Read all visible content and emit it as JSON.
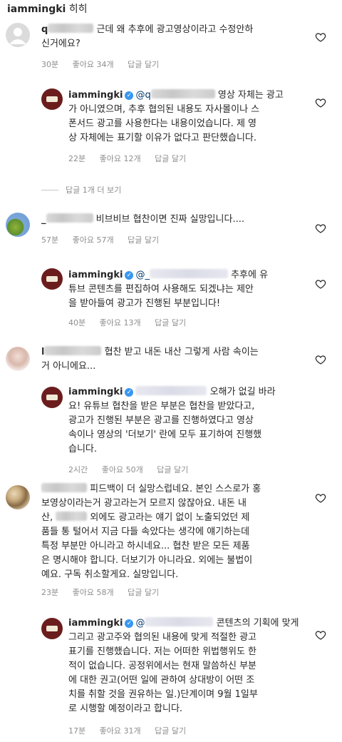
{
  "caption": {
    "username": "iammingki",
    "text": "히히"
  },
  "icons": {
    "heart": "heart-outline-icon",
    "verified": "verified-badge-icon"
  },
  "comments": [
    {
      "user_prefix": "q",
      "lines": [
        "근데 왜 추후에 광고영상이라고 수정안하",
        "신거에요?"
      ],
      "time": "30분",
      "likes": "좋아요 34개",
      "reply": "답글 달기"
    },
    {
      "user": "iammingki",
      "mention_prefix": "@q",
      "lines": [
        "영상 자체는 광고",
        "가 아니였으며, 추후 협의된 내용도 자사몰이나 스",
        "폰서드 광고를 사용한다는 내용이었습니다. 제 영",
        "상 자체에는 표기할 이유가 없다고 판단했습니다."
      ],
      "time": "22분",
      "likes": "좋아요 12개",
      "reply": "답글 달기"
    },
    {
      "view_replies": "답글 1개 더 보기"
    },
    {
      "user_prefix": "_",
      "lines": [
        "비브비브 협찬이면 진짜 실망입니다...."
      ],
      "time": "57분",
      "likes": "좋아요 57개",
      "reply": "답글 달기"
    },
    {
      "user": "iammingki",
      "mention_prefix": "@_",
      "lines": [
        "추후에 유",
        "튜브 콘텐츠를 편집하여 사용해도 되겠냐는 제안",
        "을 받아들여 광고가 진행된 부분입니다!"
      ],
      "time": "40분",
      "likes": "좋아요 13개",
      "reply": "답글 달기"
    },
    {
      "user_prefix": "l",
      "lines": [
        "협찬 받고 내돈 내산 그렇게 사람 속이는",
        "거 아니에요..."
      ],
      "time": "",
      "likes": "",
      "reply": ""
    },
    {
      "user": "iammingki",
      "lines": [
        "오해가 없길 바라",
        "요! 유튜브 협찬을 받은 부분은 협찬을 받았다고,",
        "광고가 진행된 부분은 광고를 진행하였다고 영상",
        "속이나 영상의 '더보기' 란에 모두 표기하여 진행했",
        "습니다."
      ],
      "time": "2시간",
      "likes": "좋아요 50개",
      "reply": "답글 달기"
    },
    {
      "lines": [
        "피드백이 더 실망스럽네요. 본인 스스로가 홍",
        "보영상이라는거 광고라는거 모르지 않잖아요. 내돈 내",
        "산,",
        "외에도 광고라는 얘기 없이 노출되었던 제",
        "품들 통 털어서 지금 다들 속았다는 생각에 얘기하는데",
        "특정 부분만 아니라고 하시네요... 협찬 받은 모든 제품",
        "은 명시해야 합니다. 더보기가 아니라요. 외에는 불법이",
        "예요. 구독 취소할게요. 실망입니다."
      ],
      "time": "23분",
      "likes": "좋아요 58개",
      "reply": "답글 달기"
    },
    {
      "user": "iammingki",
      "mention_prefix": "@",
      "lines": [
        "콘텐츠의 기획에 맞게",
        "그리고 광고주와 협의된 내용에 맞게 적절한 광고",
        "표기를 진행했습니다. 저는 어떠한 위법행위도 한",
        "적이 없습니다. 공정위에서는 현재 말씀하신 부분",
        "에 대한 권고(어떤 일에 관하여 상대방이 어떤 조",
        "치를 취할 것을 권유하는 일.)단계이며 9월 1일부",
        "로 시행할 예정이라고 합니다."
      ],
      "time": "17분",
      "likes": "좋아요 31개",
      "reply": "답글 달기"
    }
  ]
}
